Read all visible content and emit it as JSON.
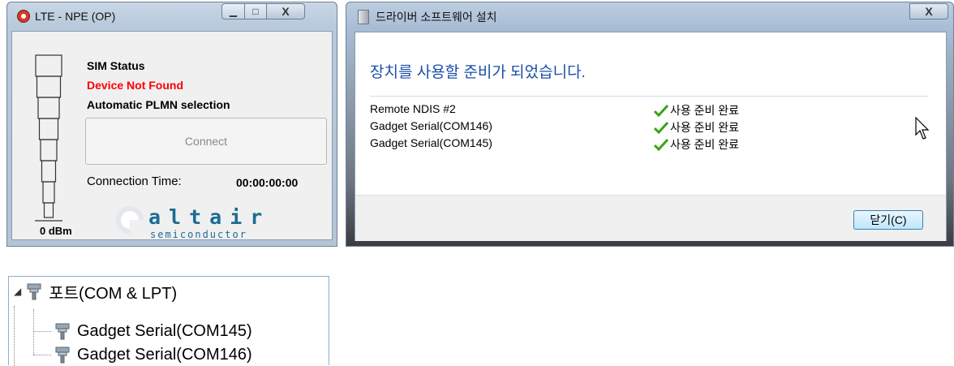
{
  "lte_window": {
    "title": "LTE - NPE (OP)",
    "close_glyph": "X",
    "sim_status_label": "SIM Status",
    "device_status": "Device Not Found",
    "plmn_mode": "Automatic PLMN selection",
    "connect_label": "Connect",
    "connection_time_label": "Connection Time:",
    "connection_time_value": "00:00:00:00",
    "signal_label": "0 dBm",
    "logo_text": "altair",
    "logo_subtext": "semiconductor",
    "colors": {
      "error": "#ff0000",
      "logo": "#1d6b95"
    }
  },
  "driver_window": {
    "title": "드라이버 소프트웨어 설치",
    "close_glyph": "X",
    "header": "장치를 사용할 준비가 되었습니다.",
    "devices": [
      {
        "name": "Remote NDIS #2",
        "status": "사용 준비 완료"
      },
      {
        "name": "Gadget Serial(COM146)",
        "status": "사용 준비 완료"
      },
      {
        "name": "Gadget Serial(COM145)",
        "status": "사용 준비 완료"
      }
    ],
    "close_button_label": "닫기(C)",
    "colors": {
      "header": "#1c4fa8",
      "check": "#3aa317"
    }
  },
  "device_tree": {
    "category": "포트(COM & LPT)",
    "children": [
      "Gadget Serial(COM145)",
      "Gadget Serial(COM146)"
    ]
  }
}
